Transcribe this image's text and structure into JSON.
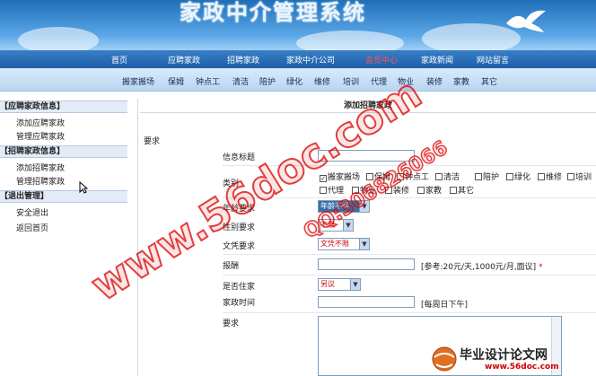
{
  "banner": {
    "title": "家政中介管理系统"
  },
  "nav_main": [
    "首页",
    "应聘家政",
    "招聘家政",
    "家政中介公司",
    "会员中心",
    "家政新闻",
    "网站留言"
  ],
  "nav_main_active": "会员中心",
  "nav_sub": [
    "搬家搬场",
    "保姆",
    "钟点工",
    "清洁",
    "陪护",
    "绿化",
    "维修",
    "培训",
    "代理",
    "物业",
    "装修",
    "家教",
    "其它"
  ],
  "sidebar": {
    "groups": [
      {
        "title": "【应聘家政信息】",
        "items": [
          "添加应聘家政",
          "管理应聘家政"
        ]
      },
      {
        "title": "【招聘家政信息】",
        "items": [
          "添加招聘家政",
          "管理招聘家政"
        ]
      },
      {
        "title": "【退出管理】",
        "items": [
          "安全退出",
          "返回首页"
        ]
      }
    ]
  },
  "main": {
    "header": "添加招聘家政",
    "req_label": "要求",
    "fields": {
      "info_title": "信息标题",
      "category": "类别",
      "age": "年龄要求",
      "gender": "性别要求",
      "education": "文凭要求",
      "salary": "报酬",
      "live_in": "是否住家",
      "work_time": "家政时间",
      "requirements": "要求"
    },
    "categories": [
      "搬家搬场",
      "保姆",
      "钟点工",
      "清洁",
      "陪护",
      "绿化",
      "维修",
      "培训",
      "代理",
      "物业",
      "装修",
      "家教",
      "其它"
    ],
    "category_checked": "搬家搬场",
    "age_value": "年龄不限",
    "gender_value": "不限",
    "education_value": "文凭不限",
    "live_in_value": "另议",
    "salary_hint": "[参考:20元/天,1000元/月,面议]",
    "salary_star": "*",
    "work_time_hint": "[每周日下午]"
  },
  "watermark": {
    "line1": "www.56doc.com",
    "line2": "QQ:306826066"
  },
  "logo": {
    "title": "毕业设计论文网",
    "url": "www.56doc.com"
  },
  "colors": {
    "nav_active": "#ff5555",
    "watermark": "#dd0000",
    "link_blue": "#1c5fa8"
  }
}
